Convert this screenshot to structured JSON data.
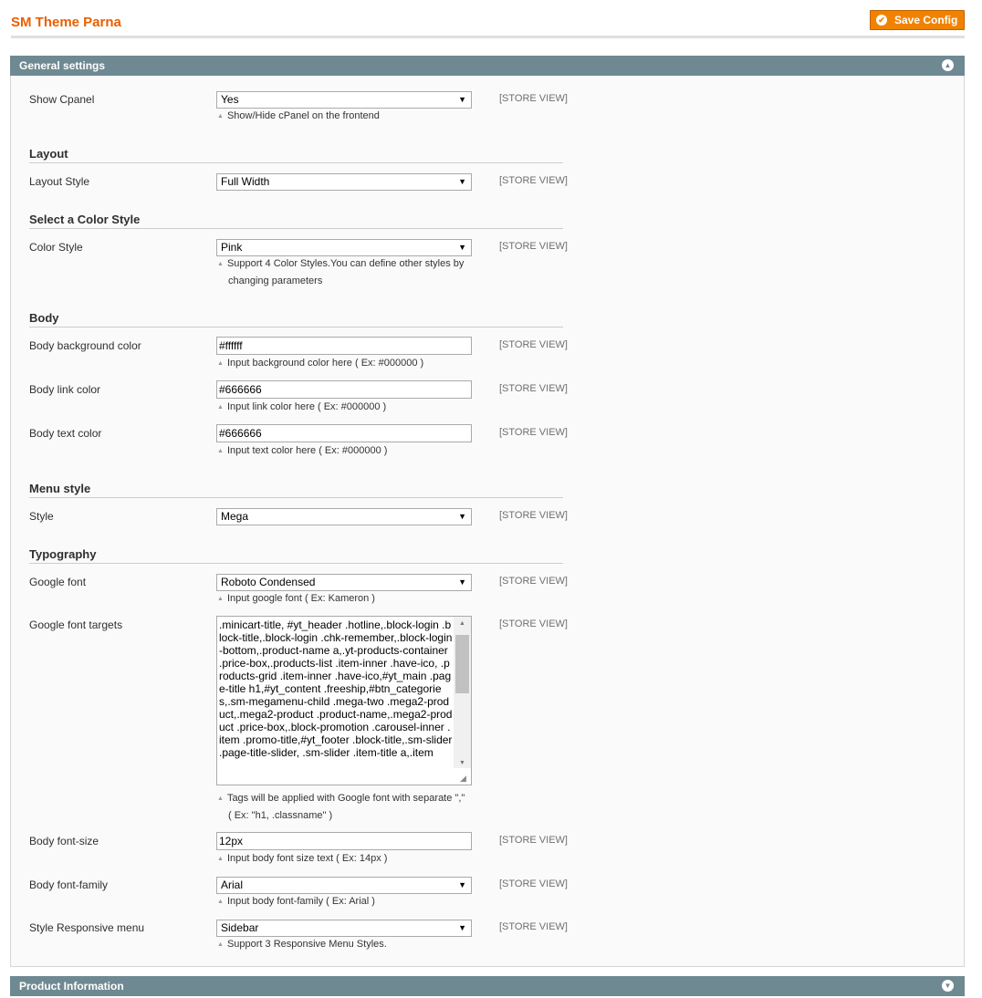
{
  "header": {
    "title": "SM Theme Parna",
    "save_label": "Save Config"
  },
  "sections": {
    "general": "General settings",
    "product": "Product Information"
  },
  "scope": "[STORE VIEW]",
  "groups": {
    "layout": "Layout",
    "color": "Select a Color Style",
    "body": "Body",
    "menu": "Menu style",
    "typography": "Typography"
  },
  "fields": {
    "show_cpanel": {
      "label": "Show Cpanel",
      "value": "Yes",
      "note": "Show/Hide cPanel on the frontend"
    },
    "layout_style": {
      "label": "Layout Style",
      "value": "Full Width"
    },
    "color_style": {
      "label": "Color Style",
      "value": "Pink",
      "note1": "Support 4 Color Styles.You can define other styles by",
      "note2": "changing parameters"
    },
    "body_bg": {
      "label": "Body background color",
      "value": "#ffffff",
      "note": "Input background color here ( Ex: #000000 )"
    },
    "body_link": {
      "label": "Body link color",
      "value": "#666666",
      "note": "Input link color here ( Ex: #000000 )"
    },
    "body_text": {
      "label": "Body text color",
      "value": "#666666",
      "note": "Input text color here ( Ex: #000000 )"
    },
    "menu_style": {
      "label": "Style",
      "value": "Mega"
    },
    "google_font": {
      "label": "Google font",
      "value": "Roboto Condensed",
      "note": "Input google font ( Ex: Kameron )"
    },
    "font_targets": {
      "label": "Google font targets",
      "value": ".minicart-title, #yt_header .hotline,.block-login .block-title,.block-login .chk-remember,.block-login-bottom,.product-name a,.yt-products-container .price-box,.products-list .item-inner .have-ico, .products-grid .item-inner .have-ico,#yt_main .page-title h1,#yt_content .freeship,#btn_categories,.sm-megamenu-child .mega-two .mega2-product,.mega2-product .product-name,.mega2-product .price-box,.block-promotion .carousel-inner .item .promo-title,#yt_footer .block-title,.sm-slider .page-title-slider, .sm-slider .item-title a,.item",
      "note1": "Tags will be applied with Google font with separate \",\"",
      "note2": "( Ex: \"h1, .classname\" )"
    },
    "body_font_size": {
      "label": "Body font-size",
      "value": "12px",
      "note": "Input body font size text ( Ex: 14px )"
    },
    "body_font_family": {
      "label": "Body font-family",
      "value": "Arial",
      "note": "Input body font-family ( Ex: Arial )"
    },
    "responsive_menu": {
      "label": "Style Responsive menu",
      "value": "Sidebar",
      "note": "Support 3 Responsive Menu Styles."
    }
  },
  "colors": {
    "accent": "#eb5e00",
    "button": "#f18200",
    "section_header": "#6f8992"
  }
}
